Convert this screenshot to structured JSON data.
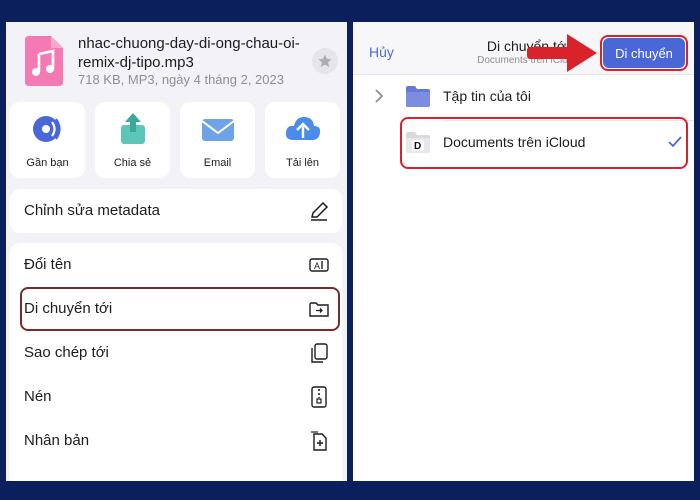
{
  "file": {
    "name": "nhac-chuong-day-di-ong-chau-oi-remix-dj-tipo.mp3",
    "meta": "718 KB, MP3, ngày 4 tháng 2, 2023"
  },
  "actions": [
    {
      "label": "Gần bạn",
      "icon": "airdrop-icon"
    },
    {
      "label": "Chia sẻ",
      "icon": "share-icon"
    },
    {
      "label": "Email",
      "icon": "email-icon"
    },
    {
      "label": "Tải lên",
      "icon": "cloud-upload-icon"
    }
  ],
  "menu": {
    "edit_metadata": "Chỉnh sửa metadata",
    "rename": "Đổi tên",
    "move_to": "Di chuyển tới",
    "copy_to": "Sao chép tới",
    "compress": "Nén",
    "duplicate": "Nhân bản"
  },
  "picker": {
    "cancel": "Hủy",
    "title": "Di chuyển tới",
    "subtitle": "Documents trên iCloud",
    "move_button": "Di chuyển",
    "locations": [
      {
        "label": "Tập tin của tôi"
      },
      {
        "label": "Documents trên iCloud",
        "selected": true
      }
    ]
  },
  "colors": {
    "accent": "#4a67d8",
    "highlight_red": "#d9232b",
    "highlight_dark": "#7a2a2a",
    "frame": "#0b1f5c"
  }
}
